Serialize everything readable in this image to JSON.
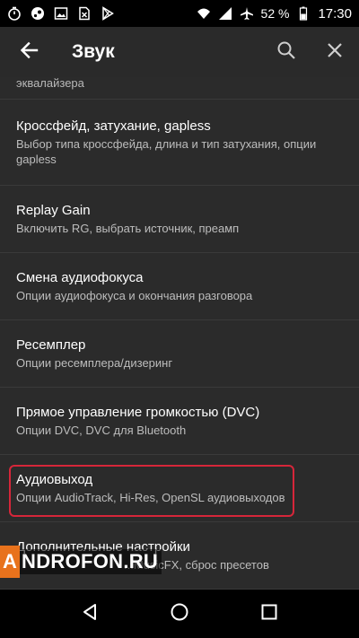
{
  "status_bar": {
    "left_icons": [
      "timer-icon",
      "steam-icon",
      "image-icon",
      "sim-card-icon",
      "playstore-icon"
    ],
    "right_icons": [
      "wifi-icon",
      "signal-icon",
      "airplane-icon"
    ],
    "battery": "52 %",
    "time": "17:30"
  },
  "app_bar": {
    "title": "Звук",
    "back_icon": "arrow-back-icon",
    "search_icon": "search-icon",
    "close_icon": "close-icon"
  },
  "settings": {
    "partial_item_subtitle": "эквалайзера",
    "items": [
      {
        "title": "Кроссфейд, затухание, gapless",
        "subtitle": "Выбор типа кроссфейда, длина и тип затухания, опции gapless"
      },
      {
        "title": "Replay Gain",
        "subtitle": "Включить RG, выбрать источник, преамп"
      },
      {
        "title": "Смена аудиофокуса",
        "subtitle": "Опции аудиофокуса и окончания разговора"
      },
      {
        "title": "Ресемплер",
        "subtitle": "Опции ресемплера/дизеринг"
      },
      {
        "title": "Прямое управление громкостью (DVC)",
        "subtitle": "Опции DVC, DVC для Bluetooth"
      },
      {
        "title": "Аудиовыход",
        "subtitle": "Опции AudioTrack, Hi-Res, OpenSL аудиовыходов"
      },
      {
        "title": "Дополнительные настройки",
        "subtitle": "...MusicFX, сброс пресетов"
      }
    ]
  },
  "watermark": {
    "badge": "A",
    "text": "NDROFON.RU"
  },
  "colors": {
    "highlight": "#d6263a",
    "background": "#2b2b2b",
    "app_bar": "#2a2a2a",
    "watermark_accent": "#e8721c"
  },
  "nav_bar": {
    "back_icon": "nav-back-triangle-icon",
    "home_icon": "nav-home-circle-icon",
    "recents_icon": "nav-recents-square-icon"
  }
}
